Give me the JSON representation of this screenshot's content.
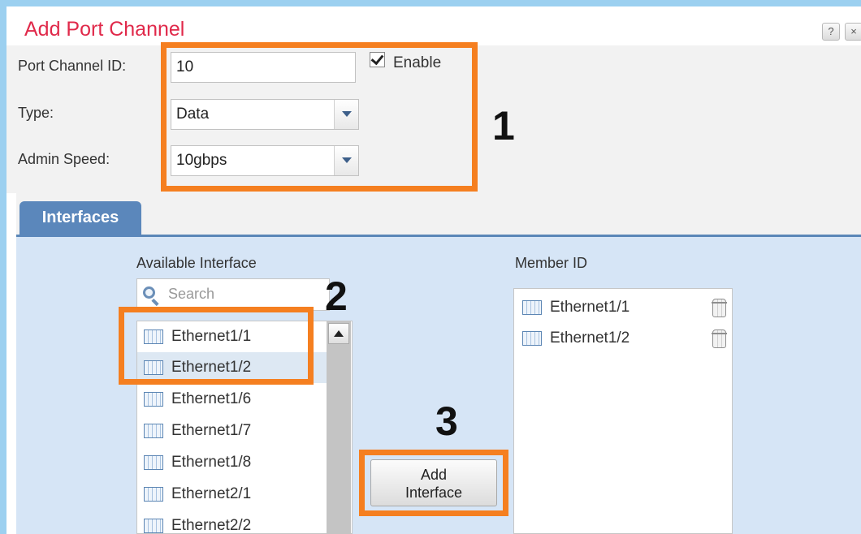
{
  "dialog": {
    "title": "Add Port Channel",
    "help_label": "?",
    "close_label": "×"
  },
  "form": {
    "port_channel_id_label": "Port Channel ID:",
    "port_channel_id_value": "10",
    "enable_label": "Enable",
    "enable_checked": true,
    "type_label": "Type:",
    "type_value": "Data",
    "admin_speed_label": "Admin Speed:",
    "admin_speed_value": "10gbps"
  },
  "tabs": [
    {
      "label": "Interfaces",
      "active": true
    }
  ],
  "available": {
    "heading": "Available Interface",
    "search_placeholder": "Search",
    "items": [
      {
        "label": "Ethernet1/1",
        "selected": false
      },
      {
        "label": "Ethernet1/2",
        "selected": true
      },
      {
        "label": "Ethernet1/6",
        "selected": false
      },
      {
        "label": "Ethernet1/7",
        "selected": false
      },
      {
        "label": "Ethernet1/8",
        "selected": false
      },
      {
        "label": "Ethernet2/1",
        "selected": false
      },
      {
        "label": "Ethernet2/2",
        "selected": false
      }
    ]
  },
  "add_button": {
    "line1": "Add",
    "line2": "Interface"
  },
  "members": {
    "heading": "Member ID",
    "items": [
      {
        "label": "Ethernet1/1"
      },
      {
        "label": "Ethernet1/2"
      }
    ]
  },
  "annotations": {
    "step1": "1",
    "step2": "2",
    "step3": "3",
    "highlight_color": "#f57f20"
  },
  "colors": {
    "title": "#e0294a",
    "tab": "#5b87bb",
    "panel": "#d6e5f6"
  }
}
